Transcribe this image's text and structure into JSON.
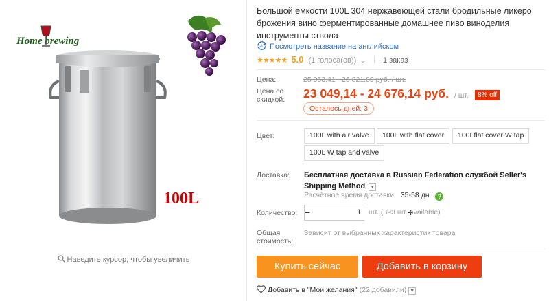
{
  "gallery": {
    "brand_text": "Home brewing",
    "volume_text": "100L",
    "zoom_hint": "Наведите курсор, чтобы увеличить",
    "icons": [
      "search-icon",
      "wine-glass-icon",
      "grapes-icon"
    ]
  },
  "product": {
    "title": "Большой емкости 100L 304 нержавеющей стали бродильные ликеро брожения вино ферментированные домашнее пиво виноделия инструменты ствола",
    "translate_link": "Посмотреть название на английском",
    "rating": {
      "stars": "★★★★★",
      "score": "5.0",
      "votes": "(1 голоса(ов))",
      "orders": "1 заказ"
    }
  },
  "price": {
    "label": "Цена:",
    "old": "25 053,41 - 26 821,89 руб. / шт.",
    "discount_label": "Цена со скидкой:",
    "new": "23 049,14 - 24 676,14 руб.",
    "unit": "/ шт.",
    "discount_badge": "8% off",
    "days_left": "Осталось дней: 3"
  },
  "color": {
    "label": "Цвет:",
    "options": [
      "100L with air valve",
      "100L with flat cover",
      "100Lflat cover W tap",
      "100L W tap and valve"
    ]
  },
  "shipping": {
    "label": "Доставка:",
    "method": "Бесплатная доставка в Russian Federation службой Seller's Shipping Method",
    "time_label": "Расчётное время доставки:",
    "time_value": "35-58 дн."
  },
  "quantity": {
    "label": "Количество:",
    "value": "1",
    "minus": "−",
    "plus": "+",
    "available": "шт. (393 шт. available)"
  },
  "total": {
    "label": "Общая стоимость:",
    "note": "Зависит от выбранных характеристик товара"
  },
  "actions": {
    "buy": "Купить сейчас",
    "cart": "Добавить в корзину",
    "wishlist": "Добавить в \"Мои желания\"",
    "wishlist_count": "(22 добавили)"
  },
  "colors": {
    "price": "#e64312",
    "buy_button": "#f7931e",
    "cart_button": "#ee3d0f",
    "link": "#2d6fd1",
    "stars": "#f2a31b"
  }
}
